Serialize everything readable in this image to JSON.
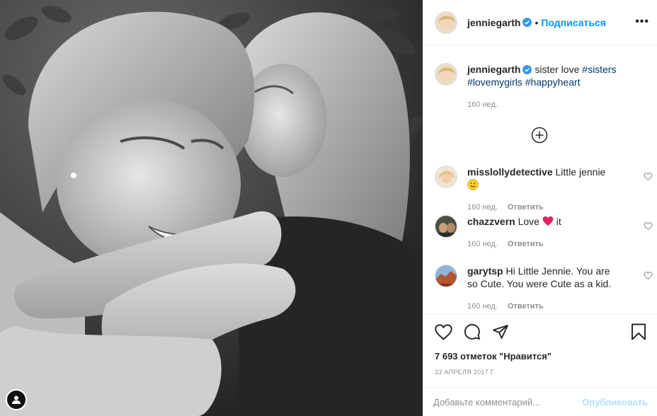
{
  "post": {
    "username": "jenniegarth",
    "follow_separator": "•",
    "follow_label": "Подписаться",
    "more_label": "•••",
    "caption_text": "sister love",
    "caption_tags": [
      "#sisters",
      "#lovemygirls",
      "#happyheart"
    ],
    "caption_time": "160 нед.",
    "likes": "7 693 отметок \"Нравится\"",
    "date": "23 АПРЕЛЯ 2017 Г."
  },
  "comments": [
    {
      "username": "misslollydetective",
      "text": "Little jennie",
      "emoji": "smile",
      "time": "160 нед.",
      "reply": "Ответить"
    },
    {
      "username": "chazzvern",
      "text_before": "Love",
      "text_after": "it",
      "emoji": "red-heart",
      "time": "160 нед.",
      "reply": "Ответить"
    },
    {
      "username": "garytsp",
      "text": "Hi Little Jennie. You are so Cute. You were Cute as a kid.",
      "time": "160 нед.",
      "reply": "Ответить"
    }
  ],
  "compose": {
    "placeholder": "Добавьте комментарий...",
    "publish_label": "Опубликовать"
  },
  "icons": [
    "verified-icon",
    "more-icon",
    "load-more-icon",
    "heart-icon",
    "comment-icon",
    "share-icon",
    "bookmark-icon",
    "profile-icon"
  ],
  "colors": {
    "link": "#00376b",
    "follow": "#0095f6",
    "publish_disabled": "#b2dffc",
    "muted": "#8e8e8e",
    "heart_emoji": "#e0245e"
  }
}
